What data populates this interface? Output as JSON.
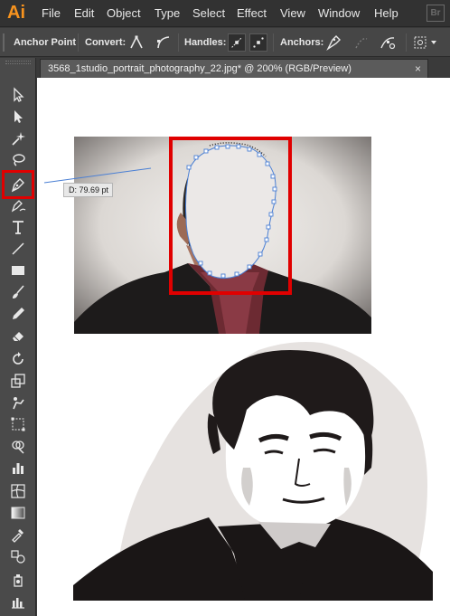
{
  "app": {
    "logo": "Ai",
    "menus": [
      "File",
      "Edit",
      "Object",
      "Type",
      "Select",
      "Effect",
      "View",
      "Window",
      "Help"
    ],
    "bridge_badge": "Br"
  },
  "controlbar": {
    "tool_name": "Anchor Point",
    "convert_label": "Convert:",
    "handles_label": "Handles:",
    "anchors_label": "Anchors:"
  },
  "document": {
    "tab_title": "3568_1studio_portrait_photography_22.jpg* @ 200% (RGB/Preview)",
    "close_glyph": "×"
  },
  "canvas": {
    "measurement_tooltip": "D: 79.69 pt"
  },
  "colors": {
    "accent_red": "#e00000",
    "path_blue": "#4a7fd4",
    "ai_orange": "#f7931e"
  },
  "tools": [
    "selection-tool",
    "direct-selection-tool",
    "magic-wand-tool",
    "lasso-tool",
    "pen-tool",
    "curvature-tool",
    "type-tool",
    "line-tool",
    "rectangle-tool",
    "paintbrush-tool",
    "pencil-tool",
    "eraser-tool",
    "rotate-tool",
    "scale-tool",
    "puppet-warp-tool",
    "free-transform-tool",
    "shape-builder-tool",
    "graph-tool",
    "mesh-tool",
    "gradient-tool",
    "eyedropper-tool",
    "blend-tool",
    "symbol-sprayer-tool",
    "column-graph-tool"
  ]
}
